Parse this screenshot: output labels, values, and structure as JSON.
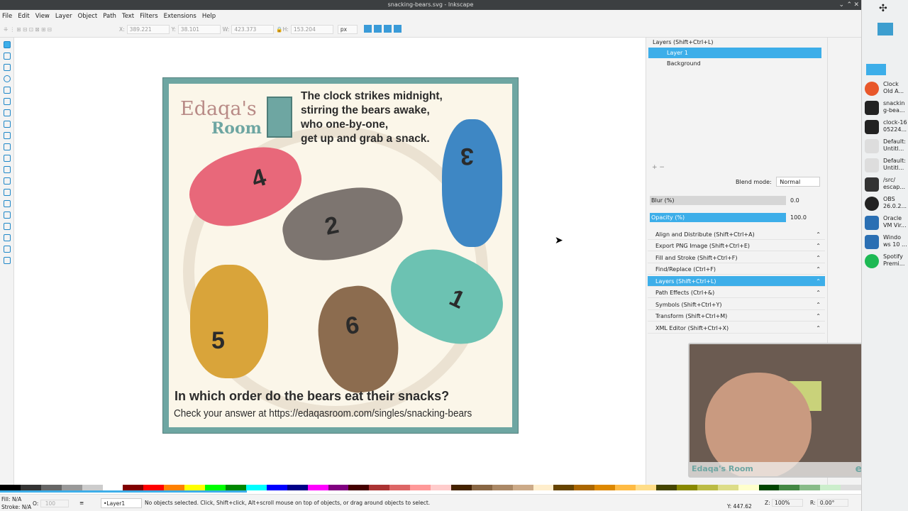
{
  "window": {
    "title": "snacking-bears.svg - Inkscape"
  },
  "menu": [
    "File",
    "Edit",
    "View",
    "Layer",
    "Object",
    "Path",
    "Text",
    "Filters",
    "Extensions",
    "Help"
  ],
  "toolbar": {
    "x_label": "X:",
    "x_value": "389.221",
    "y_label": "Y:",
    "y_value": "38.101",
    "w_label": "W:",
    "w_value": "423.373",
    "h_label": "H:",
    "h_value": "153.204",
    "unit": "px"
  },
  "artwork": {
    "logo_line1": "Edaqa's",
    "logo_line2": "Room",
    "story": [
      "The clock strikes midnight,",
      "stirring the bears awake,",
      "who one-by-one,",
      "get up and grab a snack."
    ],
    "question": "In which order do the bears   eat their snacks?",
    "check": "Check your answer at https://edaqasroom.com/singles/snacking-bears",
    "bear_numbers": [
      "4",
      "2",
      "3",
      "5",
      "6",
      "1"
    ]
  },
  "layers_panel": {
    "title": "Layers (Shift+Ctrl+L)",
    "layers": [
      {
        "name": "Layer 1",
        "selected": true
      },
      {
        "name": "Background",
        "selected": false
      }
    ],
    "blend_label": "Blend mode:",
    "blend_value": "Normal",
    "blur_label": "Blur (%)",
    "blur_value": "0.0",
    "opacity_label": "Opacity (%)",
    "opacity_value": "100.0"
  },
  "docks": [
    {
      "label": "Align and Distribute (Shift+Ctrl+A)",
      "selected": false
    },
    {
      "label": "Export PNG Image (Shift+Ctrl+E)",
      "selected": false
    },
    {
      "label": "Fill and Stroke (Shift+Ctrl+F)",
      "selected": false
    },
    {
      "label": "Find/Replace (Ctrl+F)",
      "selected": false
    },
    {
      "label": "Layers (Shift+Ctrl+L)",
      "selected": true
    },
    {
      "label": "Path Effects (Ctrl+&)",
      "selected": false
    },
    {
      "label": "Symbols (Shift+Ctrl+Y)",
      "selected": false
    },
    {
      "label": "Transform (Shift+Ctrl+M)",
      "selected": false
    },
    {
      "label": "XML Editor (Shift+Ctrl+X)",
      "selected": false
    }
  ],
  "taskbar": [
    {
      "label": "Clock Old A...",
      "color": "#e8572a"
    },
    {
      "label": "snackin g-bea...",
      "color": "#222222"
    },
    {
      "label": "clock-16 05224...",
      "color": "#222222"
    },
    {
      "label": "Default: Untitl...",
      "color": "#dddddd"
    },
    {
      "label": "Default: Untitl...",
      "color": "#dddddd"
    },
    {
      "label": "/src/ escap...",
      "color": "#333333"
    },
    {
      "label": "OBS 26.0.2...",
      "color": "#222222"
    },
    {
      "label": "Oracle VM Vir...",
      "color": "#2a6fb3"
    },
    {
      "label": "Windo ws 10 ...",
      "color": "#2a6fb3"
    },
    {
      "label": "Spotify Premi...",
      "color": "#1db954"
    }
  ],
  "status": {
    "fill_label": "Fill:",
    "fill_value": "N/A",
    "stroke_label": "Stroke:",
    "stroke_value": "N/A",
    "opacity_label": "O:",
    "opacity_value": "100",
    "layer": "•Layer1",
    "message": "No objects selected. Click, Shift+click, Alt+scroll mouse on top of objects, or drag around objects to select.",
    "x_label": "X:",
    "x_value": "",
    "y_label": "Y:",
    "y_value": "447.62",
    "zoom_label": "Z:",
    "zoom_value": "100%",
    "rotate_label": "R:",
    "rotate_value": "0.00°"
  },
  "webcam": {
    "logo": "Edaqa's Room",
    "twitter": "edaqa"
  },
  "colors": {
    "accent": "#3daee9",
    "frame": "#6ea6a2",
    "paper": "#fbf6e9"
  }
}
